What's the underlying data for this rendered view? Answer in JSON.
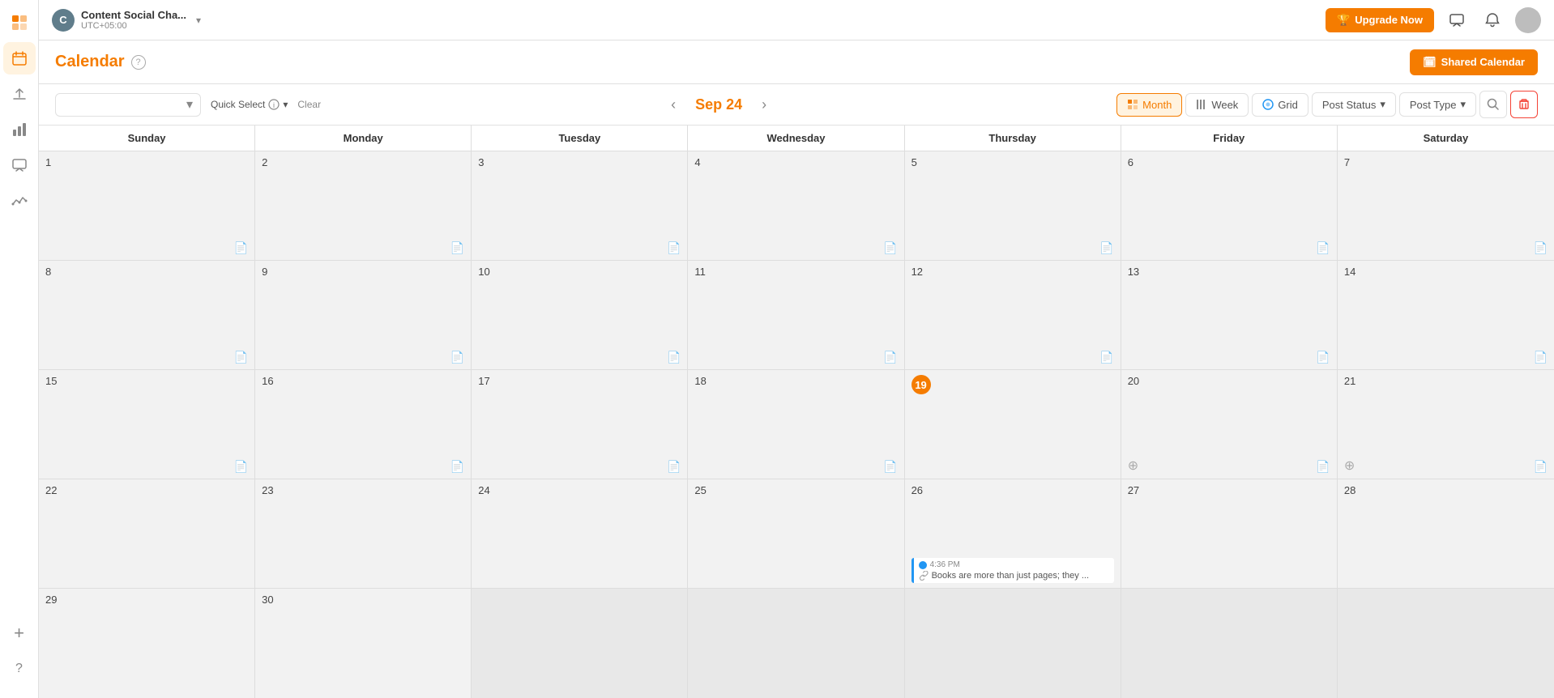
{
  "app": {
    "workspace_initial": "C",
    "workspace_name": "Content Social Cha...",
    "workspace_tz": "UTC+05:00",
    "upgrade_label": "Upgrade Now",
    "page_title": "Calendar",
    "shared_calendar_label": "Shared Calendar"
  },
  "topbar": {
    "upgrade_label": "Upgrade Now"
  },
  "calendar": {
    "current_period": "Sep 24",
    "view_month": "Month",
    "view_week": "Week",
    "view_grid": "Grid",
    "filter_post_status": "Post Status",
    "filter_post_type": "Post Type",
    "quick_select_label": "Quick Select",
    "clear_label": "Clear",
    "days": [
      "Sunday",
      "Monday",
      "Tuesday",
      "Wednesday",
      "Thursday",
      "Friday",
      "Saturday"
    ],
    "weeks": [
      [
        {
          "date": "1",
          "today": false,
          "events": [],
          "has_add": false
        },
        {
          "date": "2",
          "today": false,
          "events": [],
          "has_add": false
        },
        {
          "date": "3",
          "today": false,
          "events": [],
          "has_add": false
        },
        {
          "date": "4",
          "today": false,
          "events": [],
          "has_add": false
        },
        {
          "date": "5",
          "today": false,
          "events": [],
          "has_add": false
        },
        {
          "date": "6",
          "today": false,
          "events": [],
          "has_add": false
        },
        {
          "date": "7",
          "today": false,
          "events": [],
          "has_add": false
        }
      ],
      [
        {
          "date": "8",
          "today": false,
          "events": [],
          "has_add": false
        },
        {
          "date": "9",
          "today": false,
          "events": [],
          "has_add": false
        },
        {
          "date": "10",
          "today": false,
          "events": [],
          "has_add": false
        },
        {
          "date": "11",
          "today": false,
          "events": [],
          "has_add": false
        },
        {
          "date": "12",
          "today": false,
          "events": [],
          "has_add": false
        },
        {
          "date": "13",
          "today": false,
          "events": [],
          "has_add": false
        },
        {
          "date": "14",
          "today": false,
          "events": [],
          "has_add": false
        }
      ],
      [
        {
          "date": "15",
          "today": false,
          "events": [],
          "has_add": false
        },
        {
          "date": "16",
          "today": false,
          "events": [],
          "has_add": false
        },
        {
          "date": "17",
          "today": false,
          "events": [],
          "has_add": false
        },
        {
          "date": "18",
          "today": false,
          "events": [],
          "has_add": false
        },
        {
          "date": "19",
          "today": true,
          "events": [],
          "has_add": false
        },
        {
          "date": "20",
          "today": false,
          "events": [],
          "has_add": true
        },
        {
          "date": "21",
          "today": false,
          "events": [],
          "has_add": true
        }
      ],
      [
        {
          "date": "22",
          "today": false,
          "events": [],
          "has_add": false
        },
        {
          "date": "23",
          "today": false,
          "events": [],
          "has_add": false
        },
        {
          "date": "24",
          "today": false,
          "events": [],
          "has_add": false
        },
        {
          "date": "25",
          "today": false,
          "events": [],
          "has_add": false
        },
        {
          "date": "26",
          "today": false,
          "events": [
            {
              "time": "4:36 PM",
              "text": "Books are more than just pages; they ...",
              "color": "#2196f3"
            }
          ],
          "has_add": false
        },
        {
          "date": "27",
          "today": false,
          "events": [],
          "has_add": false
        },
        {
          "date": "28",
          "today": false,
          "events": [],
          "has_add": false
        }
      ],
      [
        {
          "date": "29",
          "today": false,
          "events": [],
          "has_add": false
        },
        {
          "date": "30",
          "today": false,
          "events": [],
          "has_add": false
        },
        {
          "date": "",
          "today": false,
          "events": [],
          "has_add": false
        },
        {
          "date": "",
          "today": false,
          "events": [],
          "has_add": false
        },
        {
          "date": "",
          "today": false,
          "events": [],
          "has_add": false
        },
        {
          "date": "",
          "today": false,
          "events": [],
          "has_add": false
        },
        {
          "date": "",
          "today": false,
          "events": [],
          "has_add": false
        }
      ]
    ]
  },
  "sidebar": {
    "items": [
      {
        "icon": "🟠",
        "name": "logo",
        "active": false
      },
      {
        "icon": "📅",
        "name": "calendar",
        "active": true
      },
      {
        "icon": "✈️",
        "name": "publish",
        "active": false
      },
      {
        "icon": "📊",
        "name": "analytics",
        "active": false
      },
      {
        "icon": "💬",
        "name": "messages",
        "active": false
      },
      {
        "icon": "📈",
        "name": "reports",
        "active": false
      }
    ],
    "bottom_items": [
      {
        "icon": "＋",
        "name": "add"
      },
      {
        "icon": "？",
        "name": "help"
      }
    ]
  }
}
